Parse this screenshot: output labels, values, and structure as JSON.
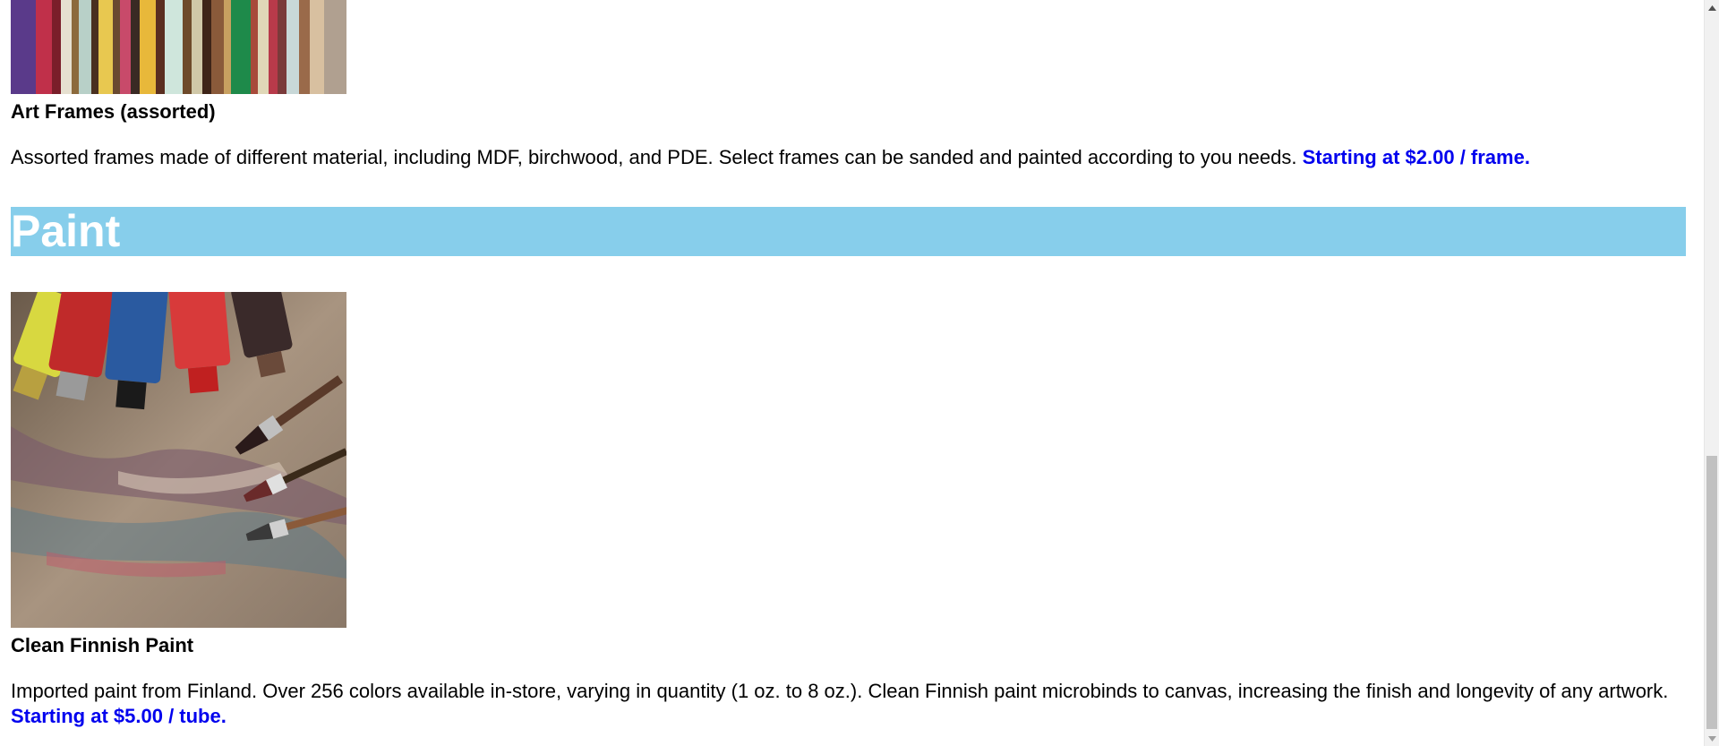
{
  "products": [
    {
      "title": "Art Frames (assorted)",
      "description": "Assorted frames made of different material, including MDF, birchwood, and PDE. Select frames can be sanded and painted according to you needs.",
      "price": "Starting at $2.00 / frame."
    },
    {
      "title": "Clean Finnish Paint",
      "description": "Imported paint from Finland. Over 256 colors available in-store, varying in quantity (1 oz. to 8 oz.). Clean Finnish paint microbinds to canvas, increasing the finish and longevity of any artwork.",
      "price": "Starting at $5.00 / tube."
    }
  ],
  "sections": {
    "paint_heading": "Paint"
  },
  "colors": {
    "section_header_bg": "#87ceeb",
    "price_link": "#0000ee",
    "scrollbar_track": "#f1f1f1",
    "scrollbar_thumb": "#c1c1c1"
  },
  "icons": {
    "scroll_up": "triangle-up-icon",
    "scroll_down": "triangle-down-icon"
  }
}
